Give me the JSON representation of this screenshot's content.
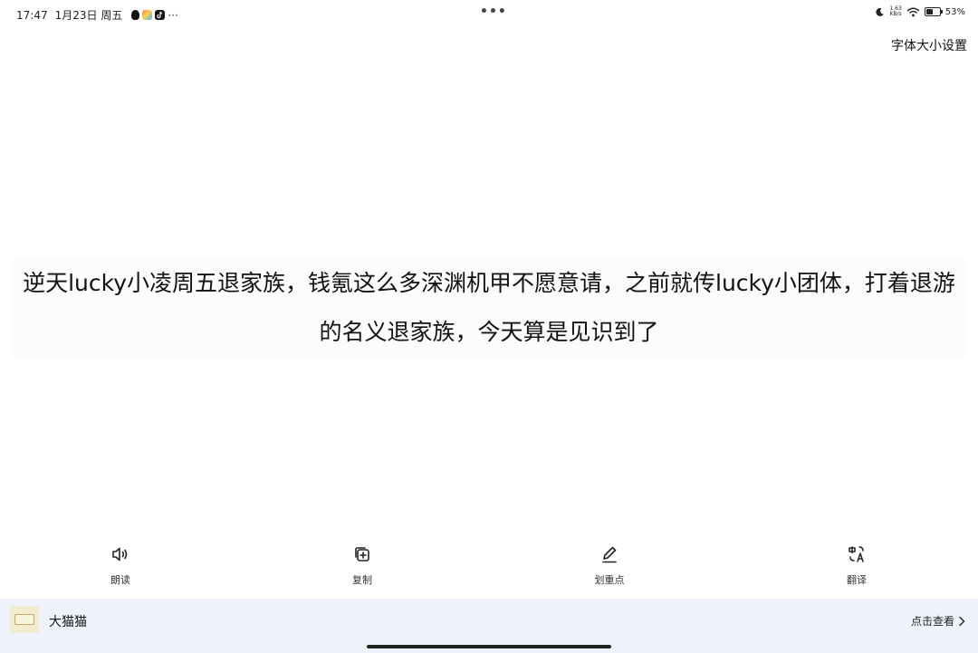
{
  "status_bar": {
    "time": "17:47",
    "date": "1月23日 周五",
    "more_dots": "···",
    "center_dots": "•••",
    "net_speed_value": "1.63",
    "net_speed_unit": "KB/s",
    "battery_percent": "53%",
    "battery_level": 0.53,
    "app_icons": [
      "qq-icon",
      "gallery-icon",
      "tiktok-icon"
    ]
  },
  "header": {
    "font_setting_label": "字体大小设置"
  },
  "content": {
    "text": "逆天lucky小凌周五退家族，钱氪这么多深渊机甲不愿意请，之前就传lucky小团体，打着退游的名义退家族，今天算是见识到了"
  },
  "toolbar": {
    "items": [
      {
        "label": "朗读",
        "icon": "speaker-icon"
      },
      {
        "label": "复制",
        "icon": "copy-icon"
      },
      {
        "label": "划重点",
        "icon": "pen-icon"
      },
      {
        "label": "翻译",
        "icon": "translate-icon"
      }
    ]
  },
  "bottom_bar": {
    "title": "大猫猫",
    "link_label": "点击查看"
  }
}
